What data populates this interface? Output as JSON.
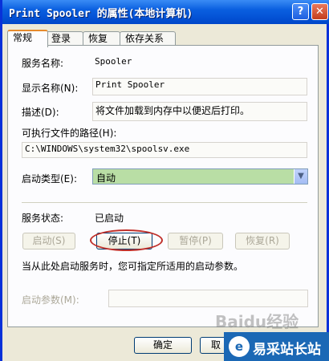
{
  "window": {
    "title": "Print Spooler 的属性(本地计算机)",
    "help_icon": "?",
    "close_icon": "✕"
  },
  "tabs": [
    {
      "label": "常规"
    },
    {
      "label": "登录"
    },
    {
      "label": "恢复"
    },
    {
      "label": "依存关系"
    }
  ],
  "general": {
    "service_name_label": "服务名称:",
    "service_name_value": "Spooler",
    "display_name_label": "显示名称(N):",
    "display_name_value": "Print Spooler",
    "description_label": "描述(D):",
    "description_value": "将文件加载到内存中以便迟后打印。",
    "exe_path_label": "可执行文件的路径(H):",
    "exe_path_value": "C:\\WINDOWS\\system32\\spoolsv.exe",
    "startup_type_label": "启动类型(E):",
    "startup_type_value": "自动",
    "status_label": "服务状态:",
    "status_value": "已启动",
    "start_button": "启动(S)",
    "stop_button": "停止(T)",
    "pause_button": "暂停(P)",
    "resume_button": "恢复(R)",
    "hint": "当从此处启动服务时，您可指定所适用的启动参数。",
    "params_label": "启动参数(M):",
    "params_value": ""
  },
  "footer": {
    "ok_button": "确定",
    "cancel_button": "取"
  },
  "watermark": {
    "baidu_text": "Baidu经验",
    "site_text": "易采站长站",
    "logo_glyph": "e"
  },
  "colors": {
    "accent_highlight": "#c0302a",
    "title_bar": "#0453d6",
    "startup_select_bg": "#b9dea5"
  }
}
